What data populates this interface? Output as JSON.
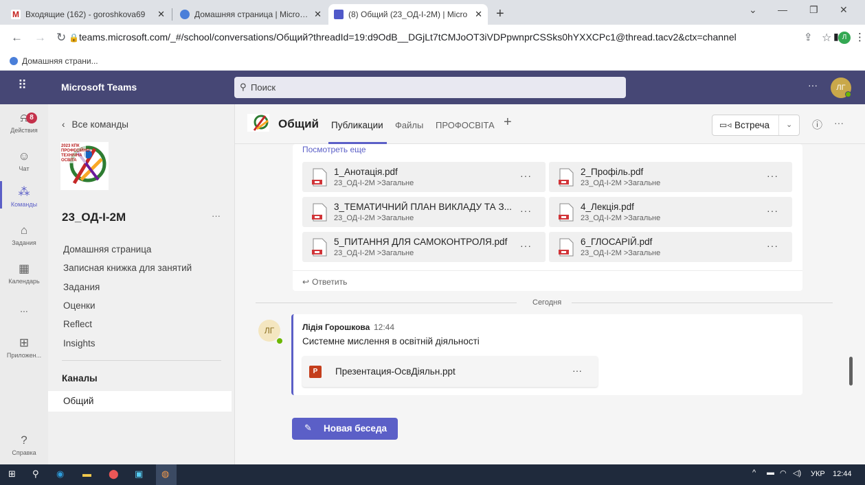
{
  "browser": {
    "tabs": [
      {
        "label": "Входящие (162) - goroshkova69",
        "icon_color": "#c5221f"
      },
      {
        "label": "Домашняя страница | Microsoft",
        "icon_color": "#4a7fd9"
      },
      {
        "label": "(8) Общий (23_ОД-І-2М) | Micro",
        "icon_color": "#5059c9"
      }
    ],
    "new_tab": "+",
    "url": "teams.microsoft.com/_#/school/conversations/Общий?threadId=19:d9OdB__DGjLt7tCMJoOT3iVDPpwnprCSSks0hYXXCPc1@thread.tacv2&ctx=channel",
    "bookmark": "Домашняя страни...",
    "profile_initial": "Л"
  },
  "teams": {
    "app_name": "Microsoft Teams",
    "search_placeholder": "Поиск",
    "more": "···",
    "avatar": "ЛГ",
    "rail": [
      {
        "label": "Действия",
        "icon": "bell-icon",
        "badge": "8"
      },
      {
        "label": "Чат",
        "icon": "chat-icon"
      },
      {
        "label": "Команды",
        "icon": "teams-icon"
      },
      {
        "label": "Задания",
        "icon": "assignments-icon"
      },
      {
        "label": "Календарь",
        "icon": "calendar-icon"
      },
      {
        "label": "...",
        "icon": "more-icon"
      },
      {
        "label": "Приложен...",
        "icon": "apps-icon"
      },
      {
        "label": "Справка",
        "icon": "help-icon"
      }
    ],
    "panel": {
      "back": "Все команды",
      "team_name": "23_ОД-І-2М",
      "team_more": "···",
      "logo_text": "2023 КПК ПРОФЕСІЙНО-ТЕХНІЧНА ОСВІТА",
      "links": [
        "Домашняя страница",
        "Записная книжка для занятий",
        "Задания",
        "Оценки",
        "Reflect",
        "Insights"
      ],
      "channels_heading": "Каналы",
      "channel": "Общий"
    },
    "channel": {
      "name": "Общий",
      "tabs": [
        "Публикации",
        "Файлы",
        "ПРОФОСВІТА"
      ],
      "add_tab": "+",
      "meet": "Встреча",
      "info_icon": "ⓘ",
      "more": "···"
    },
    "post1": {
      "see_more": "Посмотреть еще",
      "files": [
        {
          "name": "1_Анотація.pdf",
          "path": "23_ОД-І-2М >Загальне"
        },
        {
          "name": "2_Профіль.pdf",
          "path": "23_ОД-І-2М >Загальне"
        },
        {
          "name": "3_ТЕМАТИЧНИЙ ПЛАН ВИКЛАДУ ТА З...",
          "path": "23_ОД-І-2М >Загальне"
        },
        {
          "name": "4_Лекція.pdf",
          "path": "23_ОД-І-2М >Загальне"
        },
        {
          "name": "5_ПИТАННЯ ДЛЯ САМОКОНТРОЛЯ.pdf",
          "path": "23_ОД-І-2М >Загальне"
        },
        {
          "name": "6_ГЛОСАРІЙ.pdf",
          "path": "23_ОД-І-2М >Загальне"
        }
      ],
      "reply": "Ответить"
    },
    "divider": "Сегодня",
    "post2": {
      "avatar": "ЛГ",
      "author": "Лідія Горошкова",
      "time": "12:44",
      "text": "Системне мислення в освітній діяльності",
      "attachment": "Презентация-ОсвДіяльн.ppt"
    },
    "new_chat": "Новая беседа",
    "colors": {
      "header": "#464775",
      "accent": "#5b5fc7",
      "badge": "#c4314b",
      "pdf": "#d13438"
    }
  },
  "taskbar": {
    "lang": "УКР",
    "time": "12:44"
  }
}
